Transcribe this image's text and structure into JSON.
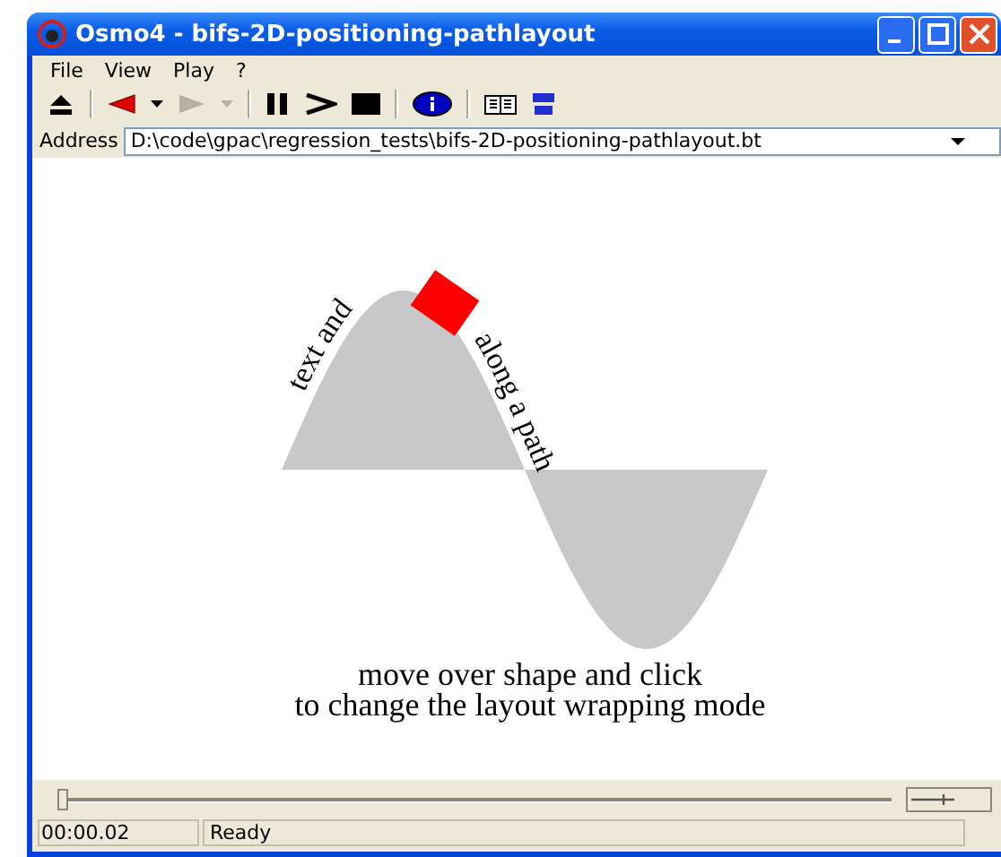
{
  "window": {
    "title": "Osmo4 - bifs-2D-positioning-pathlayout"
  },
  "menu": [
    "File",
    "View",
    "Play",
    "?"
  ],
  "address": {
    "label": "Address",
    "value": "D:\\code\\gpac\\regression_tests\\bifs-2D-positioning-pathlayout.bt"
  },
  "scene": {
    "path_texts": [
      "text and",
      "along a path"
    ],
    "caption": [
      "move over shape and click",
      "to change the layout wrapping mode"
    ]
  },
  "seek": {
    "level": 0
  },
  "status_bar": {
    "time": "00:00.02",
    "message": "Ready"
  }
}
